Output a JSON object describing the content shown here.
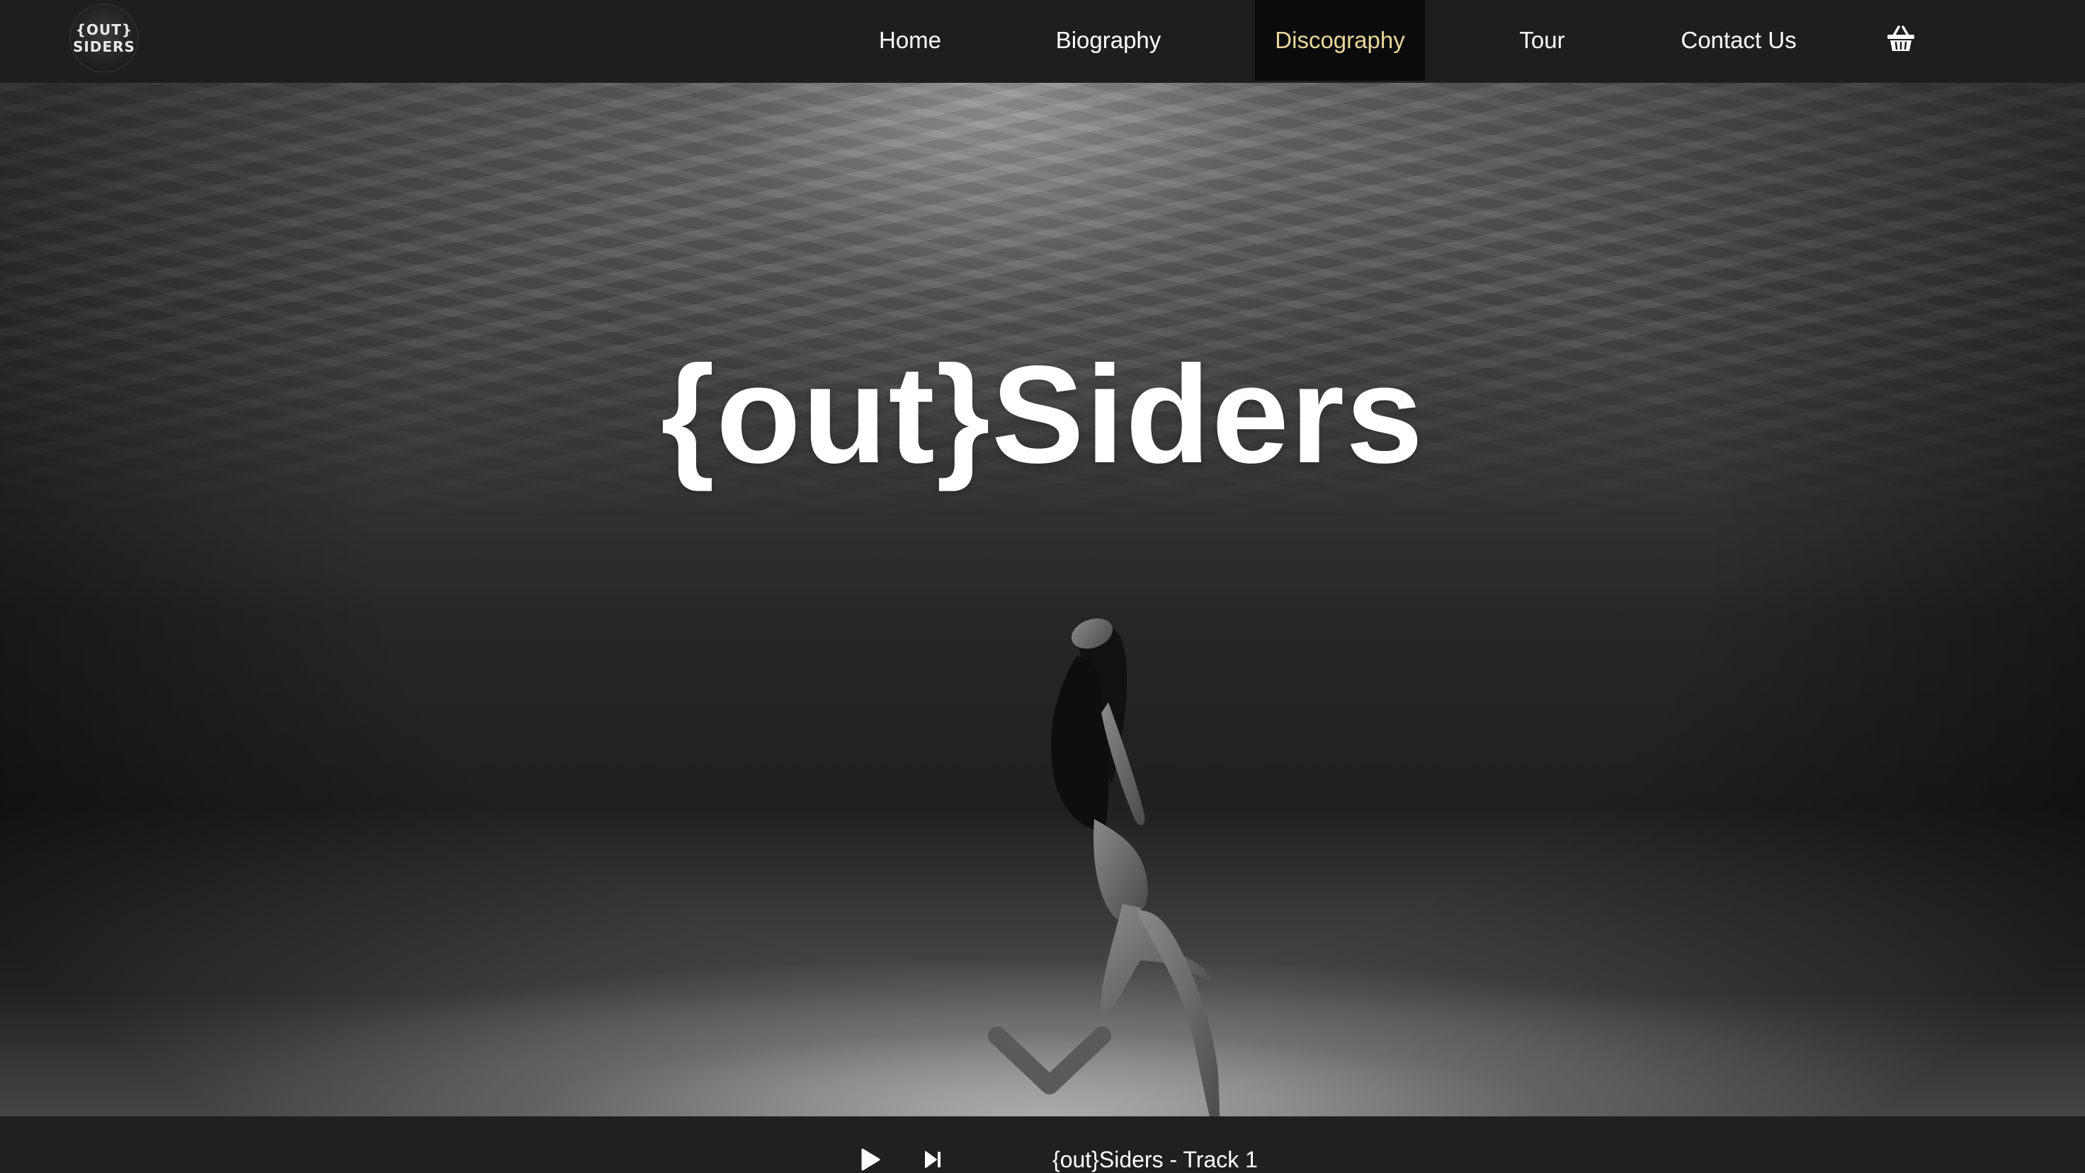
{
  "logo": {
    "line1": "{OUT}",
    "line2": "SIDERS"
  },
  "nav": {
    "items": [
      {
        "label": "Home",
        "active": false
      },
      {
        "label": "Biography",
        "active": false
      },
      {
        "label": "Discography",
        "active": true
      },
      {
        "label": "Tour",
        "active": false
      },
      {
        "label": "Contact Us",
        "active": false
      }
    ],
    "cart_icon": "shopping-basket-icon"
  },
  "hero": {
    "title": "{out}Siders",
    "background_image": "underwater-swimmer-photo",
    "scroll_icon": "chevron-down-icon"
  },
  "player": {
    "play_icon": "play-icon",
    "next_icon": "skip-next-icon",
    "track_title": "{out}Siders - Track 1"
  },
  "colors": {
    "header_bg": "#1e1e1e",
    "active_nav_bg": "#0b0b0b",
    "active_nav_text": "#e9d79a",
    "nav_text": "#ffffff",
    "player_bg": "#202020"
  }
}
